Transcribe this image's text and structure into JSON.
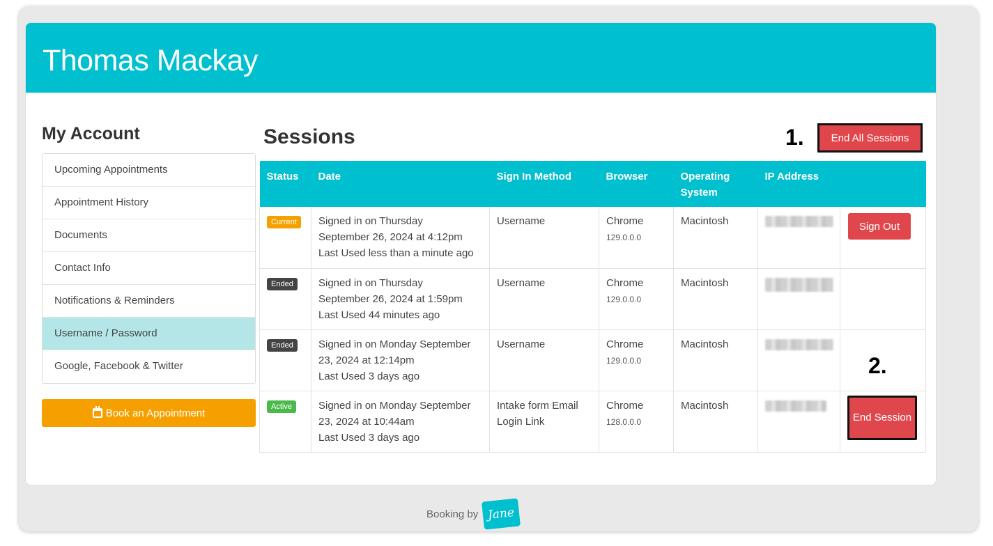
{
  "profile": {
    "name": "Thomas Mackay"
  },
  "sidebar": {
    "title": "My Account",
    "items": [
      {
        "label": "Upcoming Appointments",
        "active": false
      },
      {
        "label": "Appointment History",
        "active": false
      },
      {
        "label": "Documents",
        "active": false
      },
      {
        "label": "Contact Info",
        "active": false
      },
      {
        "label": "Notifications & Reminders",
        "active": false
      },
      {
        "label": "Username / Password",
        "active": true
      },
      {
        "label": "Google, Facebook & Twitter",
        "active": false
      }
    ],
    "book_button": {
      "label": "Book an Appointment",
      "icon": "calendar-icon"
    }
  },
  "sessions": {
    "title": "Sessions",
    "end_all_label": "End All Sessions",
    "annotations": {
      "step1": "1.",
      "step2": "2."
    },
    "columns": [
      "Status",
      "Date",
      "Sign In Method",
      "Browser",
      "Operating System",
      "IP Address",
      ""
    ],
    "rows": [
      {
        "status": "Current",
        "date_line1": "Signed in on Thursday",
        "date_line2": "September 26, 2024 at 4:12pm",
        "date_line3": "Last Used less than a minute ago",
        "method": "Username",
        "browser": "Chrome",
        "browser_version": "129.0.0.0",
        "os": "Macintosh",
        "action": "Sign Out"
      },
      {
        "status": "Ended",
        "date_line1": "Signed in on Thursday",
        "date_line2": "September 26, 2024 at 1:59pm",
        "date_line3": "Last Used 44 minutes ago",
        "method": "Username",
        "browser": "Chrome",
        "browser_version": "129.0.0.0",
        "os": "Macintosh",
        "action": ""
      },
      {
        "status": "Ended",
        "date_line1": "Signed in on Monday September",
        "date_line2": "23, 2024 at 12:14pm",
        "date_line3": "Last Used 3 days ago",
        "method": "Username",
        "browser": "Chrome",
        "browser_version": "129.0.0.0",
        "os": "Macintosh",
        "action": ""
      },
      {
        "status": "Active",
        "date_line1": "Signed in on Monday September",
        "date_line2": "23, 2024 at 10:44am",
        "date_line3": "Last Used 3 days ago",
        "method": "Intake form Email Login Link",
        "browser": "Chrome",
        "browser_version": "128.0.0.0",
        "os": "Macintosh",
        "action": "End Session"
      }
    ]
  },
  "footer": {
    "text": "Booking by",
    "logo_text": "Jane"
  },
  "colors": {
    "brand": "#00bfcf",
    "active_nav": "#b4e6e8",
    "book": "#f6a000",
    "danger": "#e0474c",
    "badge_current": "#f6a000",
    "badge_ended": "#444444",
    "badge_active": "#4cb94c"
  }
}
